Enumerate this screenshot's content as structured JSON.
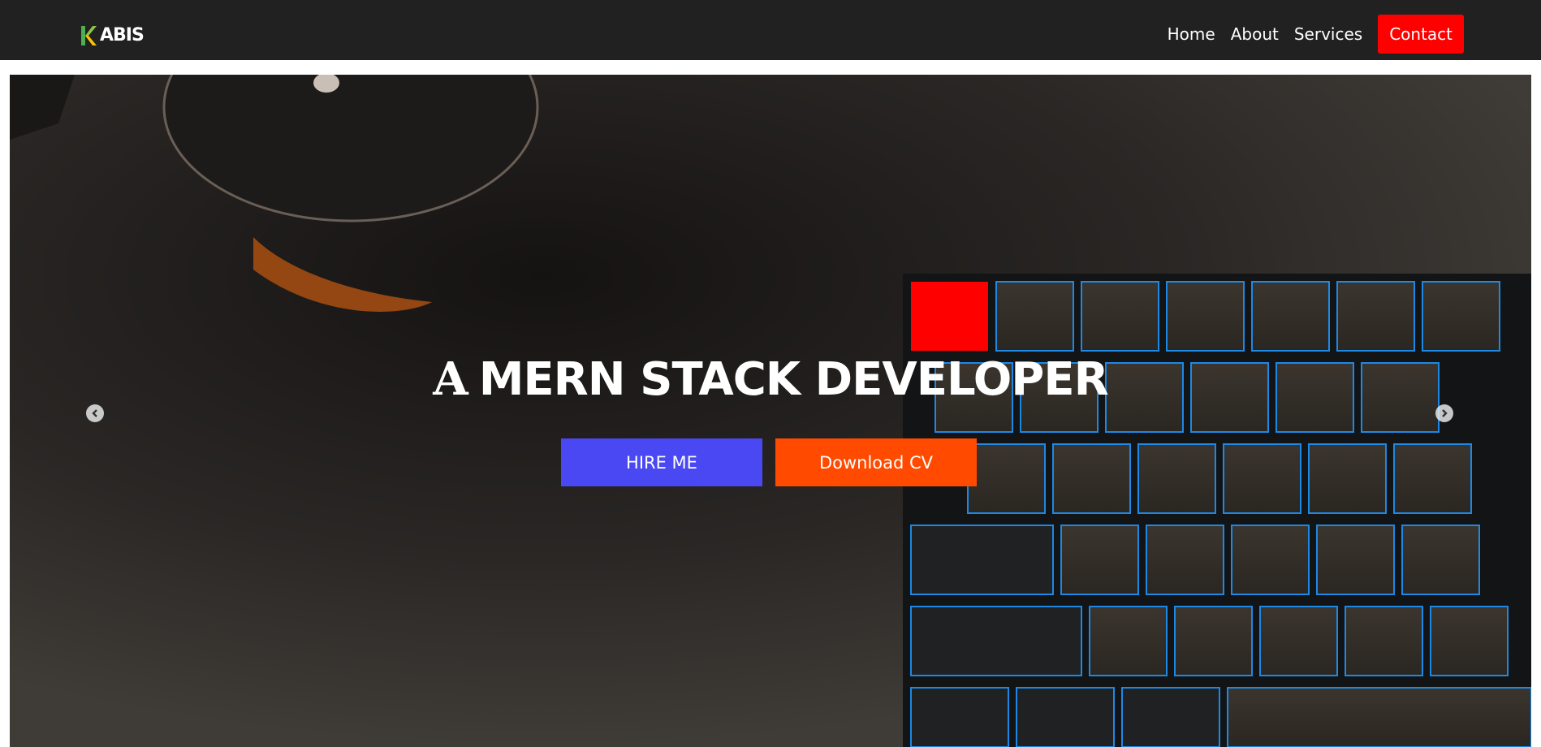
{
  "brand": {
    "name": "ABIS",
    "logo_letter": "K"
  },
  "nav": {
    "items": [
      "Home",
      "About",
      "Services"
    ],
    "contact_label": "Contact"
  },
  "hero": {
    "title_lead": "A",
    "title_rest": "MERN STACK DEVELOPER",
    "hire_label": "HIRE ME",
    "cv_label": "Download CV"
  },
  "carousel": {
    "prev_icon": "chevron-left-icon",
    "next_icon": "chevron-right-icon"
  },
  "colors": {
    "navbar": "#212121",
    "contact": "#ff0000",
    "hire": "#4a48f2",
    "download": "#ff4a00"
  }
}
